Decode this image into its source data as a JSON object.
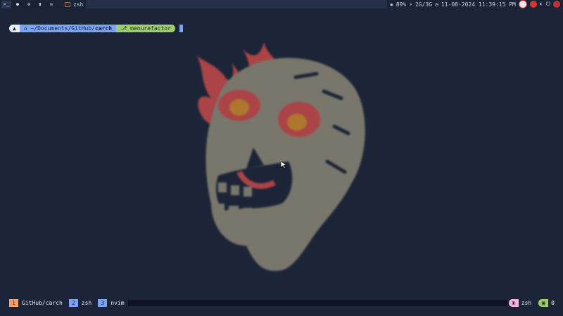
{
  "topbar": {
    "launcher_icons": [
      "terminal-icon",
      "circle-icon",
      "move-icon",
      "document-icon",
      "settings-icon"
    ],
    "window_title": "zsh",
    "battery": "89%",
    "network": "2G/3G",
    "datetime": "11-08-2024 11:39:15 PM"
  },
  "prompt": {
    "os_glyph": "▲",
    "path_prefix": "~/Documents/GitHub/",
    "path_current": "carch",
    "path_icon": "⌂",
    "git_icon": "⎇",
    "git_branch": "menurefactor"
  },
  "tmux": {
    "windows": [
      {
        "index": "1",
        "name": "GitHub/carch"
      },
      {
        "index": "2",
        "name": "zsh"
      },
      {
        "index": "3",
        "name": "nvim"
      }
    ],
    "session_name": "zsh",
    "pane_count": "0"
  },
  "colors": {
    "background": "#1c2538",
    "accent_blue": "#7aa2f7",
    "accent_green": "#9ece6a",
    "accent_orange": "#ff9e64",
    "accent_pink": "#f5b3e0"
  }
}
